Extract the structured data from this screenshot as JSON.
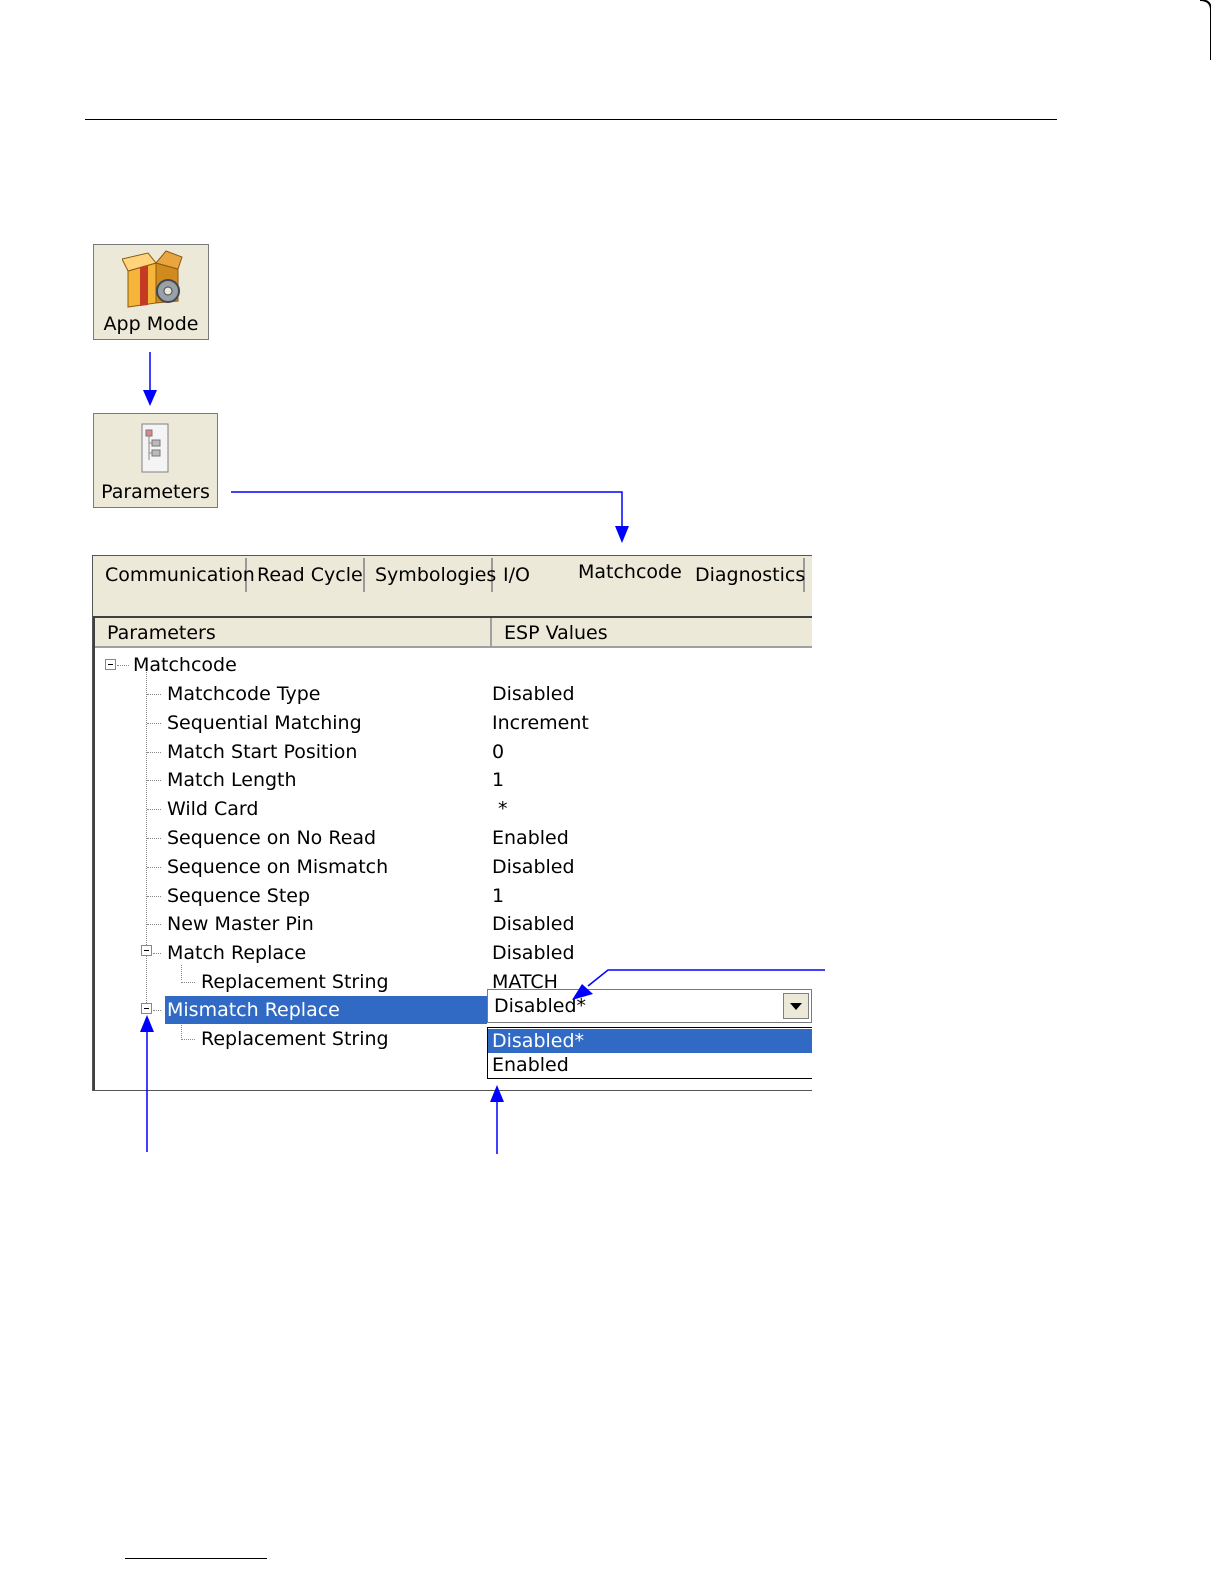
{
  "toolbar": {
    "app_mode_label": "App Mode",
    "parameters_label": "Parameters"
  },
  "tabs": [
    {
      "label": "Communication"
    },
    {
      "label": "Read Cycle"
    },
    {
      "label": "Symbologies"
    },
    {
      "label": "I/O"
    },
    {
      "label": "Matchcode",
      "active": true
    },
    {
      "label": "Diagnostics"
    }
  ],
  "grid": {
    "col_params": "Parameters",
    "col_values": "ESP Values",
    "root": "Matchcode",
    "rows": [
      {
        "name": "Matchcode Type",
        "value": "Disabled"
      },
      {
        "name": "Sequential Matching",
        "value": "Increment"
      },
      {
        "name": "Match Start Position",
        "value": "0"
      },
      {
        "name": "Match Length",
        "value": "1"
      },
      {
        "name": "Wild Card",
        "value": " *"
      },
      {
        "name": "Sequence on No Read",
        "value": "Enabled"
      },
      {
        "name": "Sequence on Mismatch",
        "value": "Disabled"
      },
      {
        "name": "Sequence Step",
        "value": "1"
      },
      {
        "name": "New Master Pin",
        "value": "Disabled"
      },
      {
        "name": "Match Replace",
        "value": "Disabled"
      },
      {
        "name": "Replacement String",
        "value": "MATCH"
      },
      {
        "name": "Mismatch Replace",
        "value": "Disabled*"
      },
      {
        "name": "Replacement String",
        "value": ""
      }
    ]
  },
  "combo": {
    "selected": "Disabled*",
    "options": [
      "Disabled*",
      "Enabled"
    ]
  },
  "colors": {
    "selection": "#316ac5",
    "arrow": "#0000ff",
    "window_bg": "#ece9d8"
  }
}
